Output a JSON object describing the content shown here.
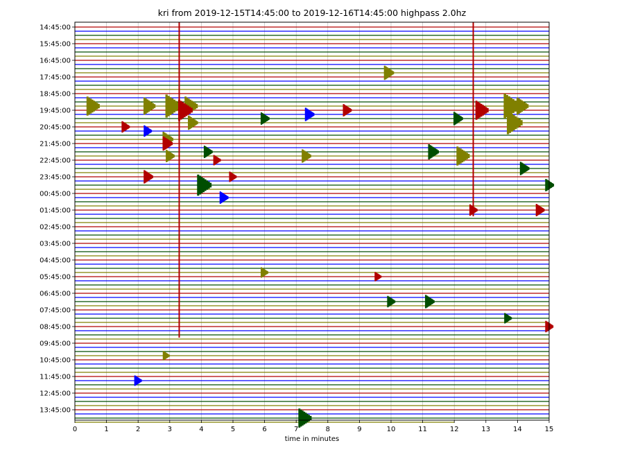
{
  "chart_data": {
    "type": "line",
    "title": "kri from 2019-12-15T14:45:00 to 2019-12-16T14:45:00 highpass 2.0hz",
    "xlabel": "time in minutes",
    "ylabel": "",
    "xlim": [
      0,
      15
    ],
    "x_ticks": [
      0,
      1,
      2,
      3,
      4,
      5,
      6,
      7,
      8,
      9,
      10,
      11,
      12,
      13,
      14,
      15
    ],
    "y_tick_labels": [
      "14:45:00",
      "15:45:00",
      "16:45:00",
      "17:45:00",
      "18:45:00",
      "19:45:00",
      "20:45:00",
      "21:45:00",
      "22:45:00",
      "23:45:00",
      "00:45:00",
      "01:45:00",
      "02:45:00",
      "03:45:00",
      "04:45:00",
      "05:45:00",
      "06:45:00",
      "07:45:00",
      "08:45:00",
      "09:45:00",
      "10:45:00",
      "11:45:00",
      "12:45:00",
      "13:45:00"
    ],
    "traces_per_hour": 4,
    "trace_minutes": 15,
    "last_trace_end_minute": 12,
    "grid": "vertical",
    "colors": [
      "#b20000",
      "#0000ff",
      "#004d00",
      "#808000"
    ],
    "events": [
      {
        "trace": 0,
        "minute": 3.3,
        "amp": 1.0
      },
      {
        "trace": 0,
        "minute": 12.6,
        "amp": 1.0
      },
      {
        "trace": 11,
        "minute": 9.8,
        "amp": 0.45
      },
      {
        "trace": 19,
        "minute": 0.4,
        "amp": 0.7
      },
      {
        "trace": 19,
        "minute": 2.2,
        "amp": 0.6
      },
      {
        "trace": 19,
        "minute": 2.9,
        "amp": 0.9
      },
      {
        "trace": 19,
        "minute": 3.5,
        "amp": 0.7
      },
      {
        "trace": 19,
        "minute": 13.6,
        "amp": 1.0
      },
      {
        "trace": 19,
        "minute": 14.0,
        "amp": 0.6
      },
      {
        "trace": 20,
        "minute": 3.3,
        "amp": 0.8
      },
      {
        "trace": 20,
        "minute": 12.7,
        "amp": 0.7
      },
      {
        "trace": 20,
        "minute": 8.5,
        "amp": 0.35
      },
      {
        "trace": 21,
        "minute": 7.3,
        "amp": 0.4
      },
      {
        "trace": 22,
        "minute": 5.9,
        "amp": 0.35
      },
      {
        "trace": 22,
        "minute": 12.0,
        "amp": 0.4
      },
      {
        "trace": 23,
        "minute": 3.6,
        "amp": 0.45
      },
      {
        "trace": 23,
        "minute": 13.7,
        "amp": 0.9
      },
      {
        "trace": 24,
        "minute": 1.5,
        "amp": 0.3
      },
      {
        "trace": 25,
        "minute": 2.2,
        "amp": 0.3
      },
      {
        "trace": 27,
        "minute": 2.8,
        "amp": 0.5
      },
      {
        "trace": 28,
        "minute": 2.8,
        "amp": 0.45
      },
      {
        "trace": 30,
        "minute": 4.1,
        "amp": 0.35
      },
      {
        "trace": 30,
        "minute": 11.2,
        "amp": 0.5
      },
      {
        "trace": 31,
        "minute": 2.9,
        "amp": 0.35
      },
      {
        "trace": 31,
        "minute": 7.2,
        "amp": 0.4
      },
      {
        "trace": 31,
        "minute": 12.1,
        "amp": 0.7
      },
      {
        "trace": 32,
        "minute": 4.4,
        "amp": 0.25
      },
      {
        "trace": 34,
        "minute": 14.1,
        "amp": 0.4
      },
      {
        "trace": 36,
        "minute": 2.2,
        "amp": 0.4
      },
      {
        "trace": 36,
        "minute": 4.9,
        "amp": 0.25
      },
      {
        "trace": 38,
        "minute": 3.9,
        "amp": 0.8
      },
      {
        "trace": 38,
        "minute": 14.9,
        "amp": 0.35
      },
      {
        "trace": 41,
        "minute": 4.6,
        "amp": 0.35
      },
      {
        "trace": 44,
        "minute": 12.5,
        "amp": 0.3
      },
      {
        "trace": 44,
        "minute": 14.6,
        "amp": 0.35
      },
      {
        "trace": 59,
        "minute": 5.9,
        "amp": 0.25
      },
      {
        "trace": 60,
        "minute": 9.5,
        "amp": 0.2
      },
      {
        "trace": 66,
        "minute": 9.9,
        "amp": 0.3
      },
      {
        "trace": 66,
        "minute": 11.1,
        "amp": 0.4
      },
      {
        "trace": 70,
        "minute": 13.6,
        "amp": 0.25
      },
      {
        "trace": 72,
        "minute": 14.9,
        "amp": 0.3
      },
      {
        "trace": 79,
        "minute": 2.8,
        "amp": 0.2
      },
      {
        "trace": 85,
        "minute": 1.9,
        "amp": 0.25
      },
      {
        "trace": 94,
        "minute": 7.1,
        "amp": 0.7
      }
    ]
  }
}
